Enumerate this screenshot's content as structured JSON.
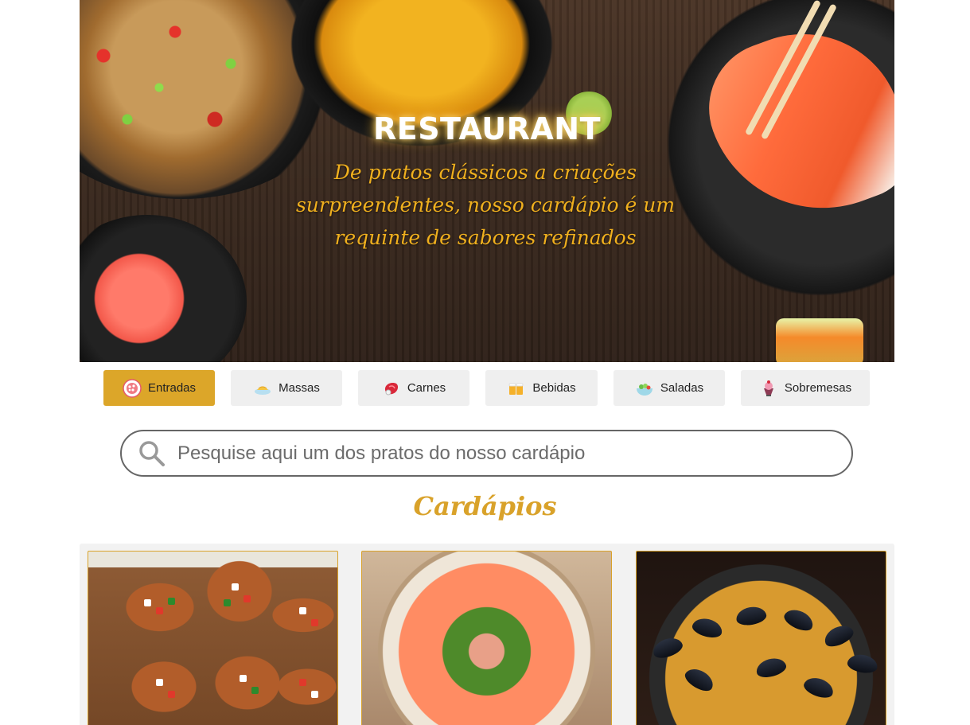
{
  "hero": {
    "title": "RESTAURANT",
    "subtitle": "De pratos clássicos a criações surpreendentes, nosso cardápio é um requinte de sabores refinados"
  },
  "categories": [
    {
      "label": "Entradas",
      "icon": "appetizer-icon",
      "active": true
    },
    {
      "label": "Massas",
      "icon": "pasta-icon",
      "active": false
    },
    {
      "label": "Carnes",
      "icon": "meat-icon",
      "active": false
    },
    {
      "label": "Bebidas",
      "icon": "drinks-icon",
      "active": false
    },
    {
      "label": "Saladas",
      "icon": "salad-icon",
      "active": false
    },
    {
      "label": "Sobremesas",
      "icon": "dessert-icon",
      "active": false
    }
  ],
  "search": {
    "placeholder": "Pesquise aqui um dos pratos do nosso cardápio",
    "value": ""
  },
  "menu": {
    "title": "Cardápios"
  },
  "colors": {
    "accent": "#dca629",
    "tab_bg": "#efefef"
  }
}
